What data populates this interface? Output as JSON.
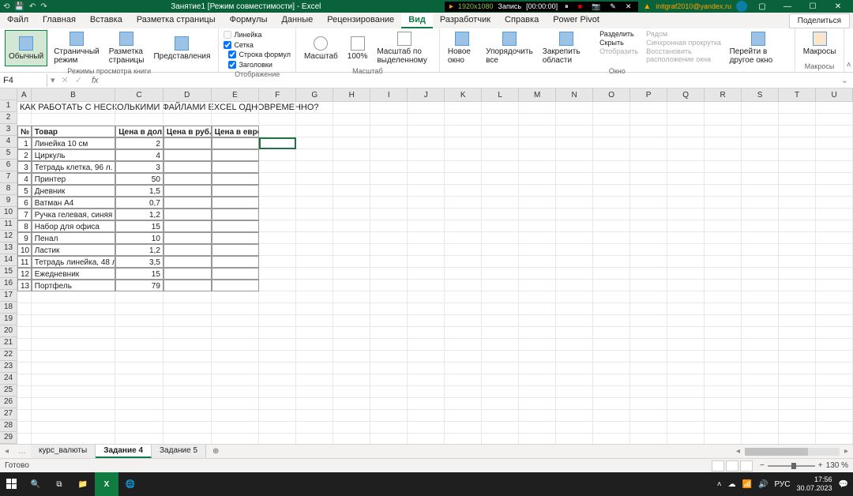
{
  "title": "Занятие1 [Режим совместимости] - Excel",
  "account": "initgraf2010@yandex.ru",
  "recording": {
    "dimensions": "1920x1080",
    "label": "Запись",
    "time": "[00:00:00]"
  },
  "menu_tabs": [
    "Файл",
    "Главная",
    "Вставка",
    "Разметка страницы",
    "Формулы",
    "Данные",
    "Рецензирование",
    "Вид",
    "Разработчик",
    "Справка",
    "Power Pivot"
  ],
  "active_menu": "Вид",
  "share": "Поделиться",
  "ribbon": {
    "views": {
      "normal": "Обычный",
      "pagebreak": "Страничный режим",
      "pagelayout": "Разметка страницы",
      "custom": "Представления",
      "group": "Режимы просмотра книги"
    },
    "show": {
      "ruler": "Линейка",
      "formula": "Строка формул",
      "grid": "Сетка",
      "headings": "Заголовки",
      "group": "Отображение"
    },
    "zoom": {
      "zoom": "Масштаб",
      "p100": "100%",
      "sel": "Масштаб по выделенному",
      "group": "Масштаб"
    },
    "window": {
      "new": "Новое окно",
      "arrange": "Упорядочить все",
      "freeze": "Закрепить области",
      "split": "Разделить",
      "hide": "Скрыть",
      "unhide": "Отобразить",
      "side": "Рядом",
      "sync": "Синхронная прокрутка",
      "reset": "Восстановить расположение окна",
      "switch": "Перейти в другое окно",
      "group": "Окно"
    },
    "macros": {
      "macros": "Макросы",
      "group": "Макросы"
    }
  },
  "namebox": "F4",
  "columns": [
    "A",
    "B",
    "C",
    "D",
    "E",
    "F",
    "G",
    "H",
    "I",
    "J",
    "K",
    "L",
    "M",
    "N",
    "O",
    "P",
    "Q",
    "R",
    "S",
    "T",
    "U"
  ],
  "a1": "КАК РАБОТАТЬ С НЕСКОЛЬКИМИ ФАЙЛАМИ EXCEL ОДНОВРЕМЕННО?",
  "headers": {
    "no": "№",
    "item": "Товар",
    "usd": "Цена в дол.",
    "rub": "Цена в руб.",
    "eur": "Цена в евро"
  },
  "rows": [
    {
      "n": "1",
      "item": "Линейка 10 см",
      "usd": "2"
    },
    {
      "n": "2",
      "item": "Циркуль",
      "usd": "4"
    },
    {
      "n": "3",
      "item": "Тетрадь клетка, 96 л.",
      "usd": "3"
    },
    {
      "n": "4",
      "item": "Принтер",
      "usd": "50"
    },
    {
      "n": "5",
      "item": "Дневник",
      "usd": "1,5"
    },
    {
      "n": "6",
      "item": "Ватман А4",
      "usd": "0,7"
    },
    {
      "n": "7",
      "item": "Ручка гелевая, синяя",
      "usd": "1,2"
    },
    {
      "n": "8",
      "item": "Набор для офиса",
      "usd": "15"
    },
    {
      "n": "9",
      "item": "Пенал",
      "usd": "10"
    },
    {
      "n": "10",
      "item": "Ластик",
      "usd": "1,2"
    },
    {
      "n": "11",
      "item": "Тетрадь линейка, 48 л.",
      "usd": "3,5"
    },
    {
      "n": "12",
      "item": "Ежедневник",
      "usd": "15"
    },
    {
      "n": "13",
      "item": "Портфель",
      "usd": "79"
    }
  ],
  "sheet_tabs": [
    "курс_валюты",
    "Задание 4",
    "Задание 5"
  ],
  "active_sheet": "Задание 4",
  "status": "Готово",
  "zoom": "130 %",
  "taskbar": {
    "lang": "РУС",
    "time": "17:56",
    "date": "30.07.2023"
  }
}
